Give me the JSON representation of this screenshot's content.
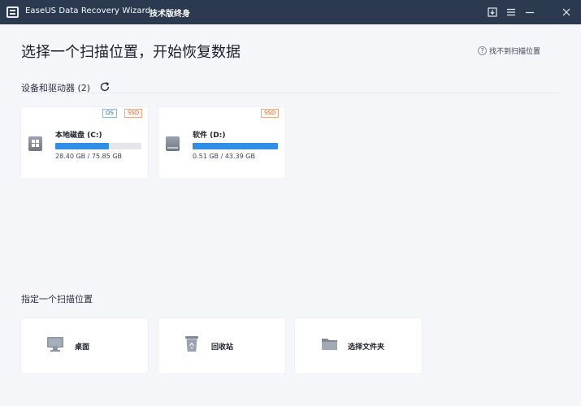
{
  "titlebar": {
    "app_title": "EaseUS Data Recovery Wizard",
    "edition": "技术版终身",
    "icons": [
      "app-logo-icon",
      "download-icon",
      "menu-icon",
      "minimize-icon",
      "close-icon"
    ]
  },
  "page": {
    "title": "选择一个扫描位置，开始恢复数据",
    "help_link": "找不到扫描位置",
    "help_glyph": "?"
  },
  "devices": {
    "label": "设备和驱动器 (2)",
    "drives": [
      {
        "name": "本地磁盘 (C:)",
        "used": "28.40 GB",
        "total": "75.85 GB",
        "size_text": "28.40 GB / 75.85 GB",
        "usage_fraction": 0.62,
        "tags": [
          "OS",
          "SSD"
        ],
        "icon": "windows-drive-icon"
      },
      {
        "name": "软件 (D:)",
        "used": "0.51 GB",
        "total": "43.39 GB",
        "size_text": "0.51 GB / 43.39 GB",
        "usage_fraction": 1.0,
        "tags": [
          "SSD"
        ],
        "icon": "hard-drive-icon"
      }
    ]
  },
  "locations": {
    "label": "指定一个扫描位置",
    "items": [
      {
        "label": "桌面",
        "icon": "desktop-icon"
      },
      {
        "label": "回收站",
        "icon": "recycle-bin-icon"
      },
      {
        "label": "选择文件夹",
        "icon": "folder-icon"
      }
    ]
  },
  "colors": {
    "titlebar": "#2b3a4f",
    "accent": "#2f8fe6",
    "background": "#f4f6fa",
    "card": "#ffffff",
    "ssd_tag": "#c9643a",
    "os_tag": "#3c6a8f"
  }
}
